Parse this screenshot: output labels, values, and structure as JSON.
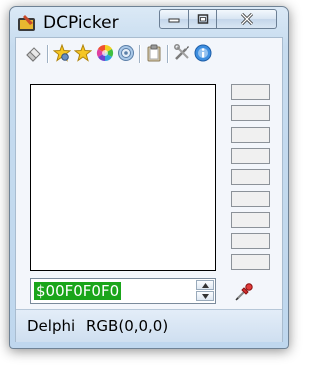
{
  "window": {
    "title": "DCPicker",
    "controls": {
      "minimize": "minimize",
      "maximize": "maximize",
      "close": "close"
    }
  },
  "toolbar": {
    "items": [
      {
        "name": "eraser-icon"
      },
      {
        "name": "star-settings-icon"
      },
      {
        "name": "star-icon"
      },
      {
        "name": "color-wheel-icon"
      },
      {
        "name": "target-icon"
      },
      {
        "name": "clipboard-icon"
      },
      {
        "name": "tools-icon"
      },
      {
        "name": "info-icon"
      }
    ]
  },
  "color": {
    "hex_value": "$00F0F0F0",
    "swatch_count": 9
  },
  "status": {
    "format": "Delphi",
    "rgb": "RGB(0,0,0)"
  },
  "colors": {
    "hex_highlight": "#1aa51a",
    "swatch_fill": "#f0f0f0"
  }
}
